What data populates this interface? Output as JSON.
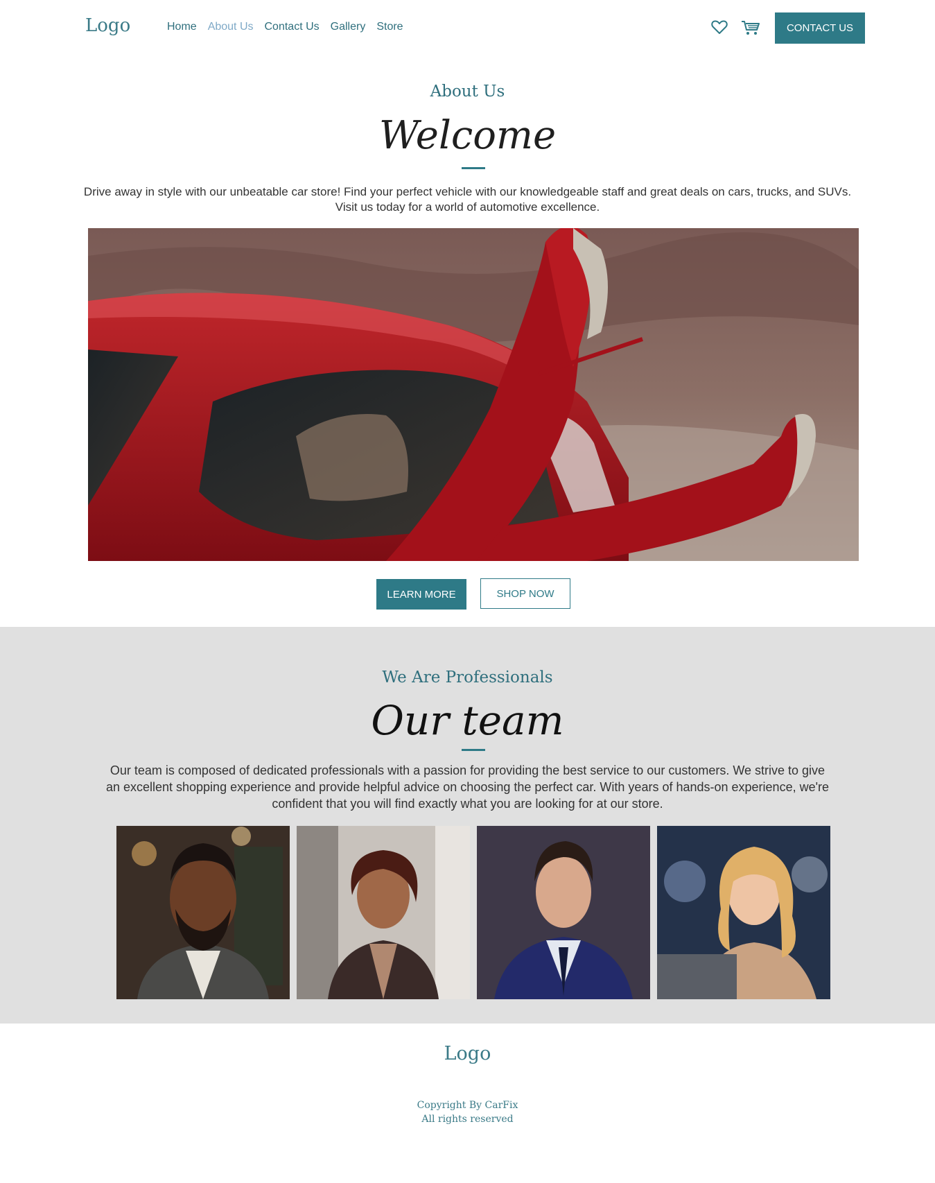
{
  "header": {
    "logo": "Logo",
    "nav": [
      {
        "label": "Home"
      },
      {
        "label": "About Us"
      },
      {
        "label": "Contact Us"
      },
      {
        "label": "Gallery"
      },
      {
        "label": "Store"
      }
    ],
    "active_nav": "About Us",
    "icons": [
      "heart-icon",
      "cart-icon"
    ],
    "contact_button": "CONTACT US"
  },
  "about": {
    "kicker": "About Us",
    "title": "Welcome",
    "description_line1": "Drive away in style with our unbeatable car store! Find your perfect vehicle with our knowledgeable staff and great deals on cars, trucks, and SUVs.",
    "description_line2": "Visit us today for a world of automotive excellence.",
    "learn_more_button": "LEARN MORE",
    "shop_now_button": "SHOP NOW"
  },
  "team": {
    "kicker": "We Are Professionals",
    "title": "Our team",
    "description_line1": "Our team is composed of dedicated professionals with a passion for providing the best service to our customers. We strive to give",
    "description_line2": "an excellent shopping experience and provide helpful advice on choosing the perfect car. With years of hands-on experience, we're",
    "description_line3": "confident that you will find exactly what you are looking for at our store."
  },
  "footer": {
    "logo": "Logo",
    "copyright": "Copyright By CarFix",
    "rights": "All rights reserved"
  },
  "colors": {
    "accent": "#2e7a87",
    "nav_active": "#7fa9c7",
    "team_background": "#e0e0e0"
  }
}
